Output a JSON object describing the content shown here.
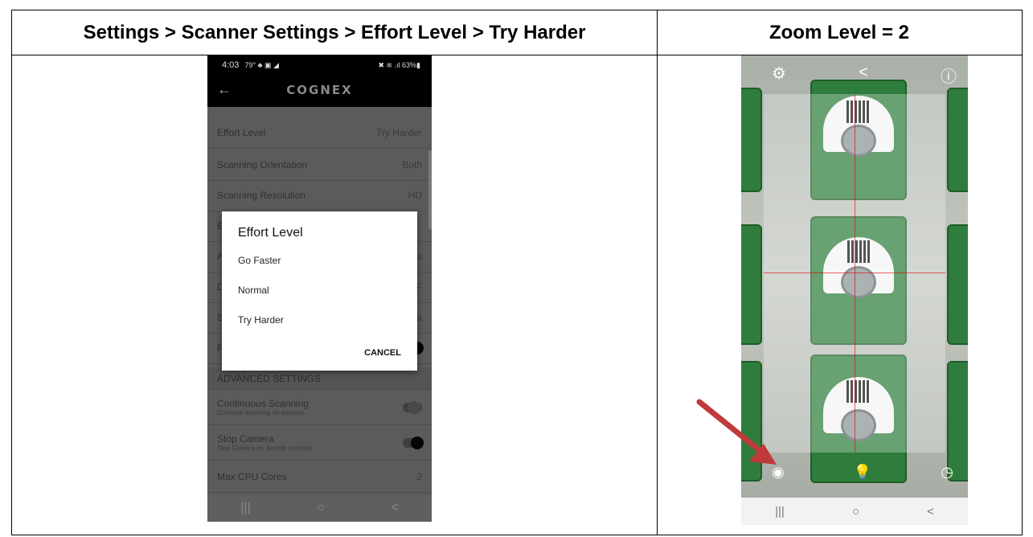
{
  "left_header": "Settings > Scanner Settings > Effort Level > Try Harder",
  "right_header": "Zoom Level = 2",
  "phone1": {
    "status": {
      "time": "4:03",
      "icons_left": "79° ♣ ▣ ◢",
      "icons_right": "✖ ≋ .ıl 63%▮"
    },
    "brand": "COGNEX",
    "back_icon": "←",
    "rows": [
      {
        "label": "Effort Level",
        "value": "Try Harder"
      },
      {
        "label": "Scanning Orientation",
        "value": "Both"
      },
      {
        "label": "Scanning Resolution",
        "value": "HD"
      }
    ],
    "hidden_row_letters": [
      "E",
      "A",
      "D",
      "S",
      "F"
    ],
    "hidden_row_values": [
      "",
      "s",
      "F",
      "a",
      ""
    ],
    "advanced": "ADVANCED SETTINGS",
    "continuous": {
      "label": "Continuous Scanning",
      "sub": "Continue scanning on success"
    },
    "stop_camera": {
      "label": "Stop Camera",
      "sub": "Stop Camera on decode success"
    },
    "max_cpu": {
      "label": "Max CPU Cores",
      "value": "2"
    },
    "dialog": {
      "title": "Effort Level",
      "options": [
        "Go Faster",
        "Normal",
        "Try Harder"
      ],
      "cancel": "CANCEL"
    },
    "nav": [
      "|||",
      "○",
      "<"
    ]
  },
  "phone2": {
    "top_icons": [
      "⚙",
      "<",
      "ⓘ"
    ],
    "bottom_icons": [
      "◉",
      "💡",
      "◷"
    ],
    "nav": [
      "|||",
      "○",
      "<"
    ]
  },
  "colors": {
    "arrow": "#c0393b",
    "pcb": "#2f7d3c"
  }
}
